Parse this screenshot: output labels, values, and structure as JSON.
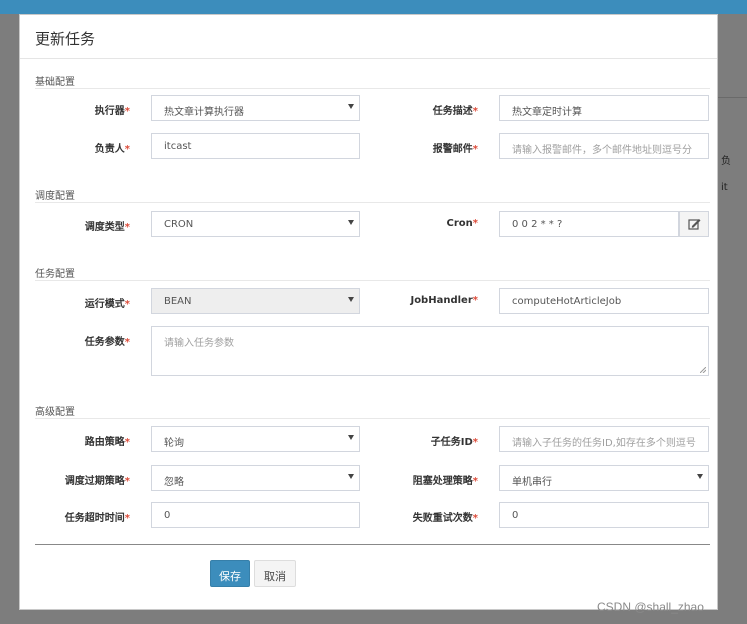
{
  "dialog": {
    "title": "更新任务",
    "save_label": "保存",
    "cancel_label": "取消"
  },
  "background": {
    "peek_1": "负",
    "peek_2": "it"
  },
  "sections": {
    "basic": "基础配置",
    "schedule": "调度配置",
    "task": "任务配置",
    "advanced": "高级配置"
  },
  "fields": {
    "executor": {
      "label": "执行器",
      "value": "热文章计算执行器"
    },
    "job_desc": {
      "label": "任务描述",
      "value": "热文章定时计算"
    },
    "owner": {
      "label": "负责人",
      "value": "itcast"
    },
    "alarm_email": {
      "label": "报警邮件",
      "placeholder": "请输入报警邮件，多个邮件地址则逗号分"
    },
    "schedule_type": {
      "label": "调度类型",
      "value": "CRON"
    },
    "cron": {
      "label": "Cron",
      "value": "0 0 2 * * ?"
    },
    "run_mode": {
      "label": "运行模式",
      "value": "BEAN"
    },
    "job_handler": {
      "label": "JobHandler",
      "value": "computeHotArticleJob"
    },
    "job_param": {
      "label": "任务参数",
      "placeholder": "请输入任务参数"
    },
    "route_strategy": {
      "label": "路由策略",
      "value": "轮询"
    },
    "child_job_id": {
      "label": "子任务ID",
      "placeholder": "请输入子任务的任务ID,如存在多个则逗号"
    },
    "misfire_strategy": {
      "label": "调度过期策略",
      "value": "忽略"
    },
    "block_strategy": {
      "label": "阻塞处理策略",
      "value": "单机串行"
    },
    "timeout": {
      "label": "任务超时时间",
      "value": "0"
    },
    "fail_retry": {
      "label": "失败重试次数",
      "value": "0"
    }
  },
  "required_mark": "*",
  "watermark": "CSDN @shall_zhao",
  "colors": {
    "primary": "#3c8dbc",
    "required": "#dd4b39",
    "backdrop": "#7d7d7d"
  }
}
